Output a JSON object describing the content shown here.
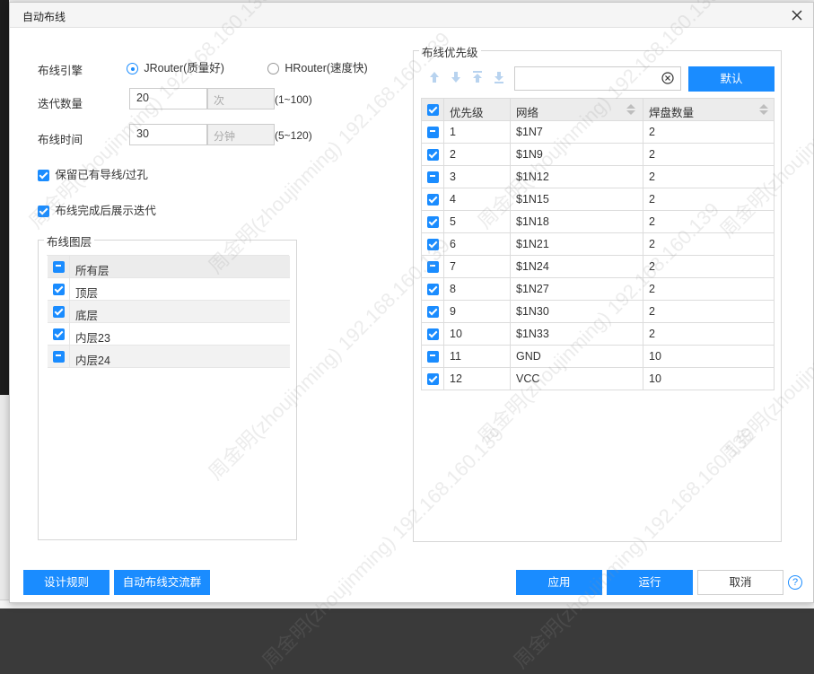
{
  "dialog": {
    "title": "自动布线"
  },
  "engine": {
    "label": "布线引擎",
    "options": [
      {
        "label": "JRouter(质量好)",
        "selected": true
      },
      {
        "label": "HRouter(速度快)",
        "selected": false
      }
    ]
  },
  "iterations": {
    "label": "迭代数量",
    "value": "20",
    "unit": "次",
    "range": "(1~100)"
  },
  "time": {
    "label": "布线时间",
    "value": "30",
    "unit": "分钟",
    "range": "(5~120)"
  },
  "options": {
    "keep_existing": "保留已有导线/过孔",
    "show_iterations": "布线完成后展示迭代"
  },
  "layers": {
    "legend": "布线图层",
    "header": "所有层",
    "items": [
      "顶层",
      "底层",
      "内层23",
      "内层24"
    ]
  },
  "priority": {
    "legend": "布线优先级",
    "search_value": "",
    "default_button": "默认",
    "columns": [
      "优先级",
      "网络",
      "焊盘数量"
    ],
    "rows": [
      {
        "priority": "1",
        "net": "$1N7",
        "pads": "2"
      },
      {
        "priority": "2",
        "net": "$1N9",
        "pads": "2"
      },
      {
        "priority": "3",
        "net": "$1N12",
        "pads": "2"
      },
      {
        "priority": "4",
        "net": "$1N15",
        "pads": "2"
      },
      {
        "priority": "5",
        "net": "$1N18",
        "pads": "2"
      },
      {
        "priority": "6",
        "net": "$1N21",
        "pads": "2"
      },
      {
        "priority": "7",
        "net": "$1N24",
        "pads": "2"
      },
      {
        "priority": "8",
        "net": "$1N27",
        "pads": "2"
      },
      {
        "priority": "9",
        "net": "$1N30",
        "pads": "2"
      },
      {
        "priority": "10",
        "net": "$1N33",
        "pads": "2"
      },
      {
        "priority": "11",
        "net": "GND",
        "pads": "10"
      },
      {
        "priority": "12",
        "net": "VCC",
        "pads": "10"
      }
    ]
  },
  "footer": {
    "design_rules": "设计规则",
    "community": "自动布线交流群",
    "apply": "应用",
    "run": "运行",
    "cancel": "取消",
    "help": "?"
  },
  "watermark": "周金明(zhoujinming) 192.168.160.139",
  "colors": {
    "accent": "#1a8cff",
    "header_bg": "#ececec"
  }
}
